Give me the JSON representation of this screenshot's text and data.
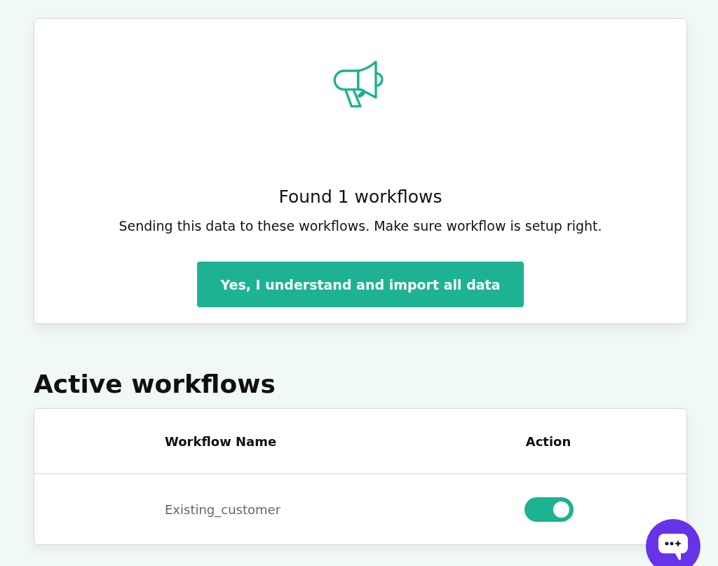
{
  "notice": {
    "title": "Found 1 workflows",
    "message": "Sending this data to these workflows. Make sure workflow is setup right.",
    "button": "Yes, I understand and import all data"
  },
  "section_title": "Active workflows",
  "table": {
    "columns": [
      "Workflow Name",
      "Action"
    ],
    "rows": [
      {
        "name": "Existing_customer",
        "on": true
      }
    ]
  }
}
